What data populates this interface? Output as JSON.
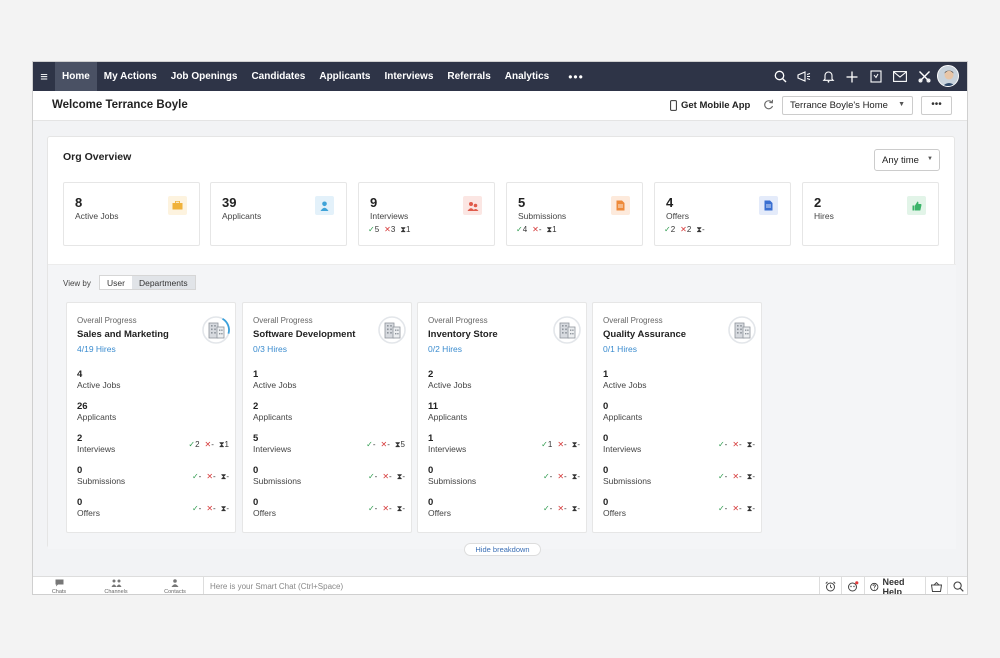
{
  "nav": {
    "items": [
      "Home",
      "My Actions",
      "Job Openings",
      "Candidates",
      "Applicants",
      "Interviews",
      "Referrals",
      "Analytics"
    ],
    "more": "•••"
  },
  "header": {
    "welcome": "Welcome Terrance Boyle",
    "mobile_app": "Get Mobile App",
    "home_select": "Terrance Boyle's Home",
    "more": "•••"
  },
  "overview": {
    "title": "Org Overview",
    "timeframe": "Any time",
    "stats": [
      {
        "value": "8",
        "label": "Active Jobs",
        "icon": "briefcase-icon",
        "color": "#f0b23b"
      },
      {
        "value": "39",
        "label": "Applicants",
        "icon": "person-icon",
        "color": "#3fa3d8"
      },
      {
        "value": "9",
        "label": "Interviews",
        "icon": "group-icon",
        "color": "#e05b4b",
        "marks": [
          "5",
          "3",
          "1"
        ]
      },
      {
        "value": "5",
        "label": "Submissions",
        "icon": "document-icon",
        "color": "#ee8a3a",
        "marks": [
          "4",
          "-",
          "1"
        ]
      },
      {
        "value": "4",
        "label": "Offers",
        "icon": "file-icon",
        "color": "#3a6fd1",
        "marks": [
          "2",
          "2",
          "-"
        ]
      },
      {
        "value": "2",
        "label": "Hires",
        "icon": "thumbs-up-icon",
        "color": "#3cb46a"
      }
    ]
  },
  "view_by": {
    "label": "View by",
    "options": [
      "User",
      "Departments"
    ],
    "selected": "Departments"
  },
  "departments": [
    {
      "progress_label": "Overall Progress",
      "name": "Sales and Marketing",
      "hires": "4/19 Hires",
      "progress": 0.21,
      "rows": [
        {
          "value": "4",
          "label": "Active Jobs"
        },
        {
          "value": "26",
          "label": "Applicants"
        },
        {
          "value": "2",
          "label": "Interviews",
          "marks": [
            "2",
            "-",
            "1"
          ]
        },
        {
          "value": "0",
          "label": "Submissions",
          "marks": [
            "-",
            "-",
            "-"
          ]
        },
        {
          "value": "0",
          "label": "Offers",
          "marks": [
            "-",
            "-",
            "-"
          ]
        }
      ]
    },
    {
      "progress_label": "Overall Progress",
      "name": "Software Development",
      "hires": "0/3 Hires",
      "progress": 0,
      "rows": [
        {
          "value": "1",
          "label": "Active Jobs"
        },
        {
          "value": "2",
          "label": "Applicants"
        },
        {
          "value": "5",
          "label": "Interviews",
          "marks": [
            "-",
            "-",
            "5"
          ]
        },
        {
          "value": "0",
          "label": "Submissions",
          "marks": [
            "-",
            "-",
            "-"
          ]
        },
        {
          "value": "0",
          "label": "Offers",
          "marks": [
            "-",
            "-",
            "-"
          ]
        }
      ]
    },
    {
      "progress_label": "Overall Progress",
      "name": "Inventory Store",
      "hires": "0/2 Hires",
      "progress": 0,
      "rows": [
        {
          "value": "2",
          "label": "Active Jobs"
        },
        {
          "value": "11",
          "label": "Applicants"
        },
        {
          "value": "1",
          "label": "Interviews",
          "marks": [
            "1",
            "-",
            "-"
          ]
        },
        {
          "value": "0",
          "label": "Submissions",
          "marks": [
            "-",
            "-",
            "-"
          ]
        },
        {
          "value": "0",
          "label": "Offers",
          "marks": [
            "-",
            "-",
            "-"
          ]
        }
      ]
    },
    {
      "progress_label": "Overall Progress",
      "name": "Quality Assurance",
      "hires": "0/1 Hires",
      "progress": 0,
      "rows": [
        {
          "value": "1",
          "label": "Active Jobs"
        },
        {
          "value": "0",
          "label": "Applicants"
        },
        {
          "value": "0",
          "label": "Interviews",
          "marks": [
            "-",
            "-",
            "-"
          ]
        },
        {
          "value": "0",
          "label": "Submissions",
          "marks": [
            "-",
            "-",
            "-"
          ]
        },
        {
          "value": "0",
          "label": "Offers",
          "marks": [
            "-",
            "-",
            "-"
          ]
        }
      ]
    }
  ],
  "hide_breakdown": "Hide breakdown",
  "footer": {
    "tabs": [
      "Chats",
      "Channels",
      "Contacts"
    ],
    "smart_chat_placeholder": "Here is your Smart Chat (Ctrl+Space)",
    "need_help": "Need Help"
  }
}
